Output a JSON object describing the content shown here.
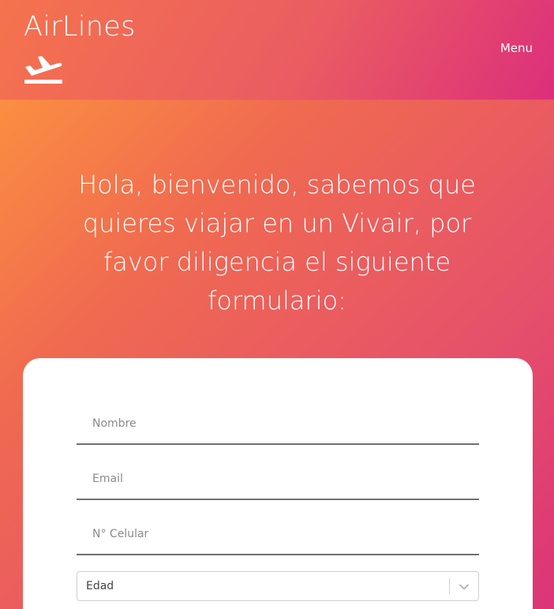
{
  "header": {
    "brand": "AirLines",
    "logo_icon": "plane-takeoff-icon",
    "menu_label": "Menu"
  },
  "hero": {
    "title": "Hola, bienvenido, sabemos que quieres viajar en un Vivair, por favor diligencia el siguiente formulario:"
  },
  "form": {
    "nombre_placeholder": "Nombre",
    "nombre_value": "",
    "email_placeholder": "Email",
    "email_value": "",
    "celular_placeholder": "N° Celular",
    "celular_value": "",
    "edad_selected": "Edad",
    "edad_icon": "chevron-down-icon"
  },
  "colors": {
    "gradient_start": "#ff9a3c",
    "gradient_end": "#db3477",
    "card_background": "#ffffff",
    "text_on_gradient": "#ffffff"
  }
}
